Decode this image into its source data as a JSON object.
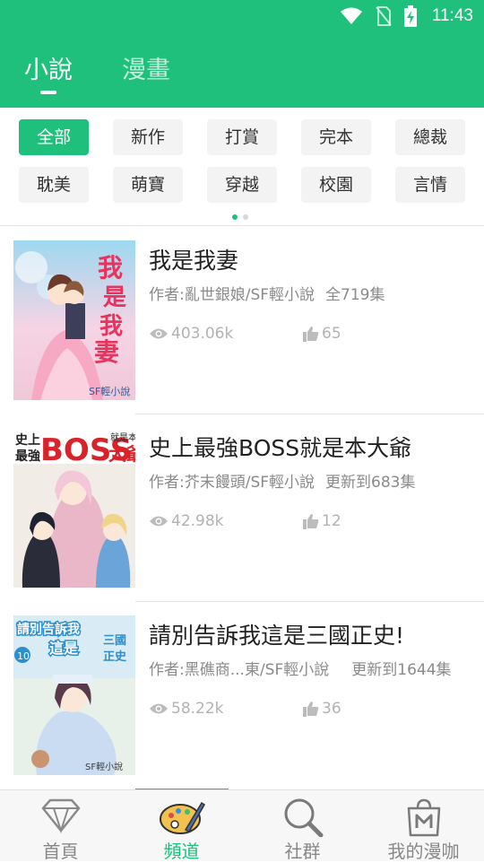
{
  "status": {
    "time": "11:43"
  },
  "tabs": [
    {
      "label": "小說",
      "active": true
    },
    {
      "label": "漫畫",
      "active": false
    }
  ],
  "categories": {
    "row1": [
      "全部",
      "新作",
      "打賞",
      "完本",
      "總裁"
    ],
    "row2": [
      "耽美",
      "萌寶",
      "穿越",
      "校園",
      "言情"
    ],
    "active": "全部"
  },
  "books": [
    {
      "title": "我是我妻",
      "author": "作者:亂世銀娘/SF輕小說",
      "progress": "全719集",
      "views": "403.06k",
      "likes": "65"
    },
    {
      "title": "史上最強BOSS就是本大爺",
      "author": "作者:芥末饅頭/SF輕小說",
      "progress": "更新到683集",
      "views": "42.98k",
      "likes": "12"
    },
    {
      "title": "請別告訴我這是三國正史!",
      "author": "作者:黑礁商...東/SF輕小說",
      "progress": "更新到1644集",
      "views": "58.22k",
      "likes": "36"
    }
  ],
  "covers": [
    {
      "text": "我是我妻",
      "brand": "SF輕小說"
    },
    {
      "text": "史上最強BOSS就是本大爺",
      "brand": ""
    },
    {
      "text": "請別告訴我這是三國正史",
      "brand": "SF輕小說"
    }
  ],
  "bottom_nav": [
    {
      "label": "首頁",
      "icon": "diamond-icon",
      "active": false
    },
    {
      "label": "頻道",
      "icon": "palette-icon",
      "active": true
    },
    {
      "label": "社群",
      "icon": "search-icon",
      "active": false
    },
    {
      "label": "我的漫咖",
      "icon": "shopping-bag-icon",
      "active": false
    }
  ],
  "colors": {
    "accent": "#1ec07c",
    "text": "#222222",
    "meta": "#8a8a8a"
  }
}
